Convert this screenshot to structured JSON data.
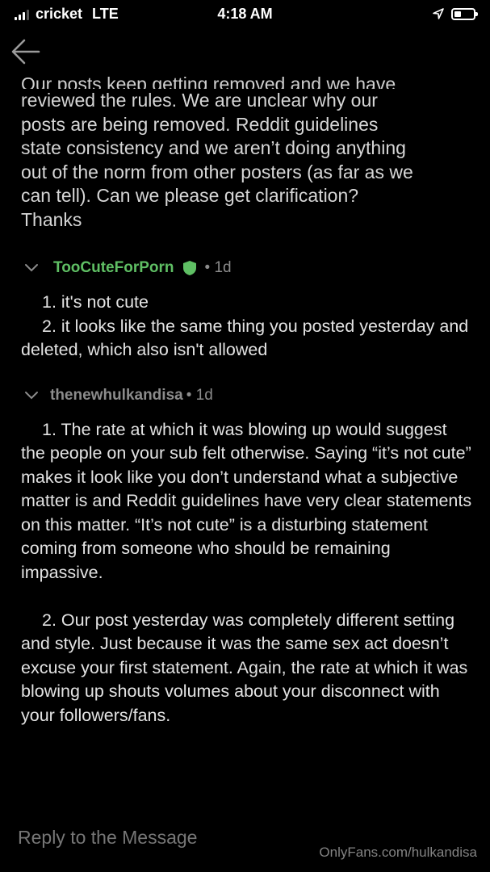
{
  "status_bar": {
    "carrier": "cricket",
    "network": "LTE",
    "time": "4:18 AM"
  },
  "message": {
    "clipped_top_line": "Our posts keep getting removed and we have",
    "body": "reviewed the rules.  We are unclear why our\nposts are being removed.  Reddit guidelines\nstate consistency and we aren’t doing anything\nout of the norm from other posters (as far as we\ncan tell).  Can we please get clarification?\nThanks"
  },
  "comments": [
    {
      "username": "TooCuteForPorn",
      "is_moderator": true,
      "age": "• 1d",
      "paragraphs": [
        "1. it's not cute",
        "2. it looks like the same thing you posted yesterday and deleted, which also isn't allowed"
      ]
    },
    {
      "username": "thenewhulkandisa",
      "is_moderator": false,
      "age": "• 1d",
      "paragraphs": [
        "1. The rate at which it was blowing up would suggest the people on your sub felt otherwise. Saying “it’s not cute” makes it look like you don’t understand what a subjective matter is and Reddit guidelines have very clear statements on this matter.   “It’s not cute” is a disturbing statement coming from someone who should be remaining impassive.",
        "2. Our post yesterday was completely different setting and style.  Just because it was the same sex act doesn’t excuse your first statement.  Again, the rate at which it was blowing up shouts volumes about your disconnect with your followers/fans."
      ]
    }
  ],
  "reply": {
    "placeholder": "Reply to the Message"
  },
  "watermark": "OnlyFans.com/hulkandisa",
  "colors": {
    "background": "#000000",
    "moderator_name": "#5fbf64",
    "meta_text": "#8c8c8c"
  },
  "icons": {
    "back": "arrow-left-icon",
    "collapse": "chevron-down-icon",
    "mod": "shield-icon",
    "location": "location-arrow-icon"
  }
}
